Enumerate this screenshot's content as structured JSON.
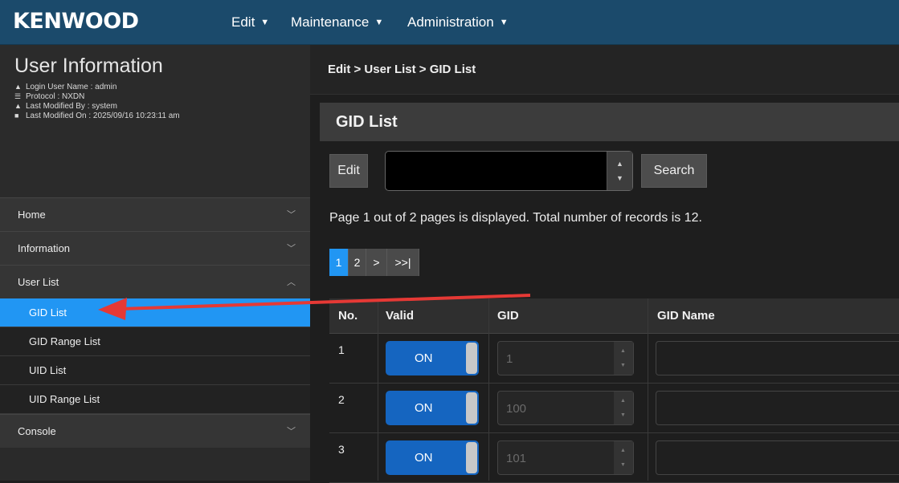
{
  "app": {
    "logo": "KENWOOD"
  },
  "menu": [
    {
      "label": "Edit"
    },
    {
      "label": "Maintenance"
    },
    {
      "label": "Administration"
    }
  ],
  "user_info": {
    "title": "User Information",
    "login_user": "Login User Name : admin",
    "protocol": "Protocol : NXDN",
    "modified_by": "Last Modified By : system",
    "modified_on": "Last Modified On : 2025/09/16 10:23:11 am"
  },
  "sidebar": {
    "home": "Home",
    "information": "Information",
    "user_list": "User List",
    "sub": [
      "GID List",
      "GID Range List",
      "UID List",
      "UID Range List"
    ],
    "console": "Console"
  },
  "breadcrumb": "Edit  >  User List  >  GID List",
  "panel": {
    "title": "GID List"
  },
  "toolbar": {
    "edit_label": "Edit",
    "search_label": "Search",
    "search_value": ""
  },
  "status_text": "Page 1 out of 2 pages is displayed. Total number of records is 12.",
  "pager": [
    "1",
    "2",
    ">",
    ">>|"
  ],
  "table": {
    "headers": [
      "No.",
      "Valid",
      "GID",
      "GID Name"
    ],
    "rows": [
      {
        "no": "1",
        "valid": "ON",
        "gid": "1",
        "name": ""
      },
      {
        "no": "2",
        "valid": "ON",
        "gid": "100",
        "name": ""
      },
      {
        "no": "3",
        "valid": "ON",
        "gid": "101",
        "name": ""
      }
    ]
  },
  "colors": {
    "topbar": "#1b4a6b",
    "accent": "#2196f3",
    "toggle_on": "#1565c0",
    "arrow": "#e53935"
  }
}
